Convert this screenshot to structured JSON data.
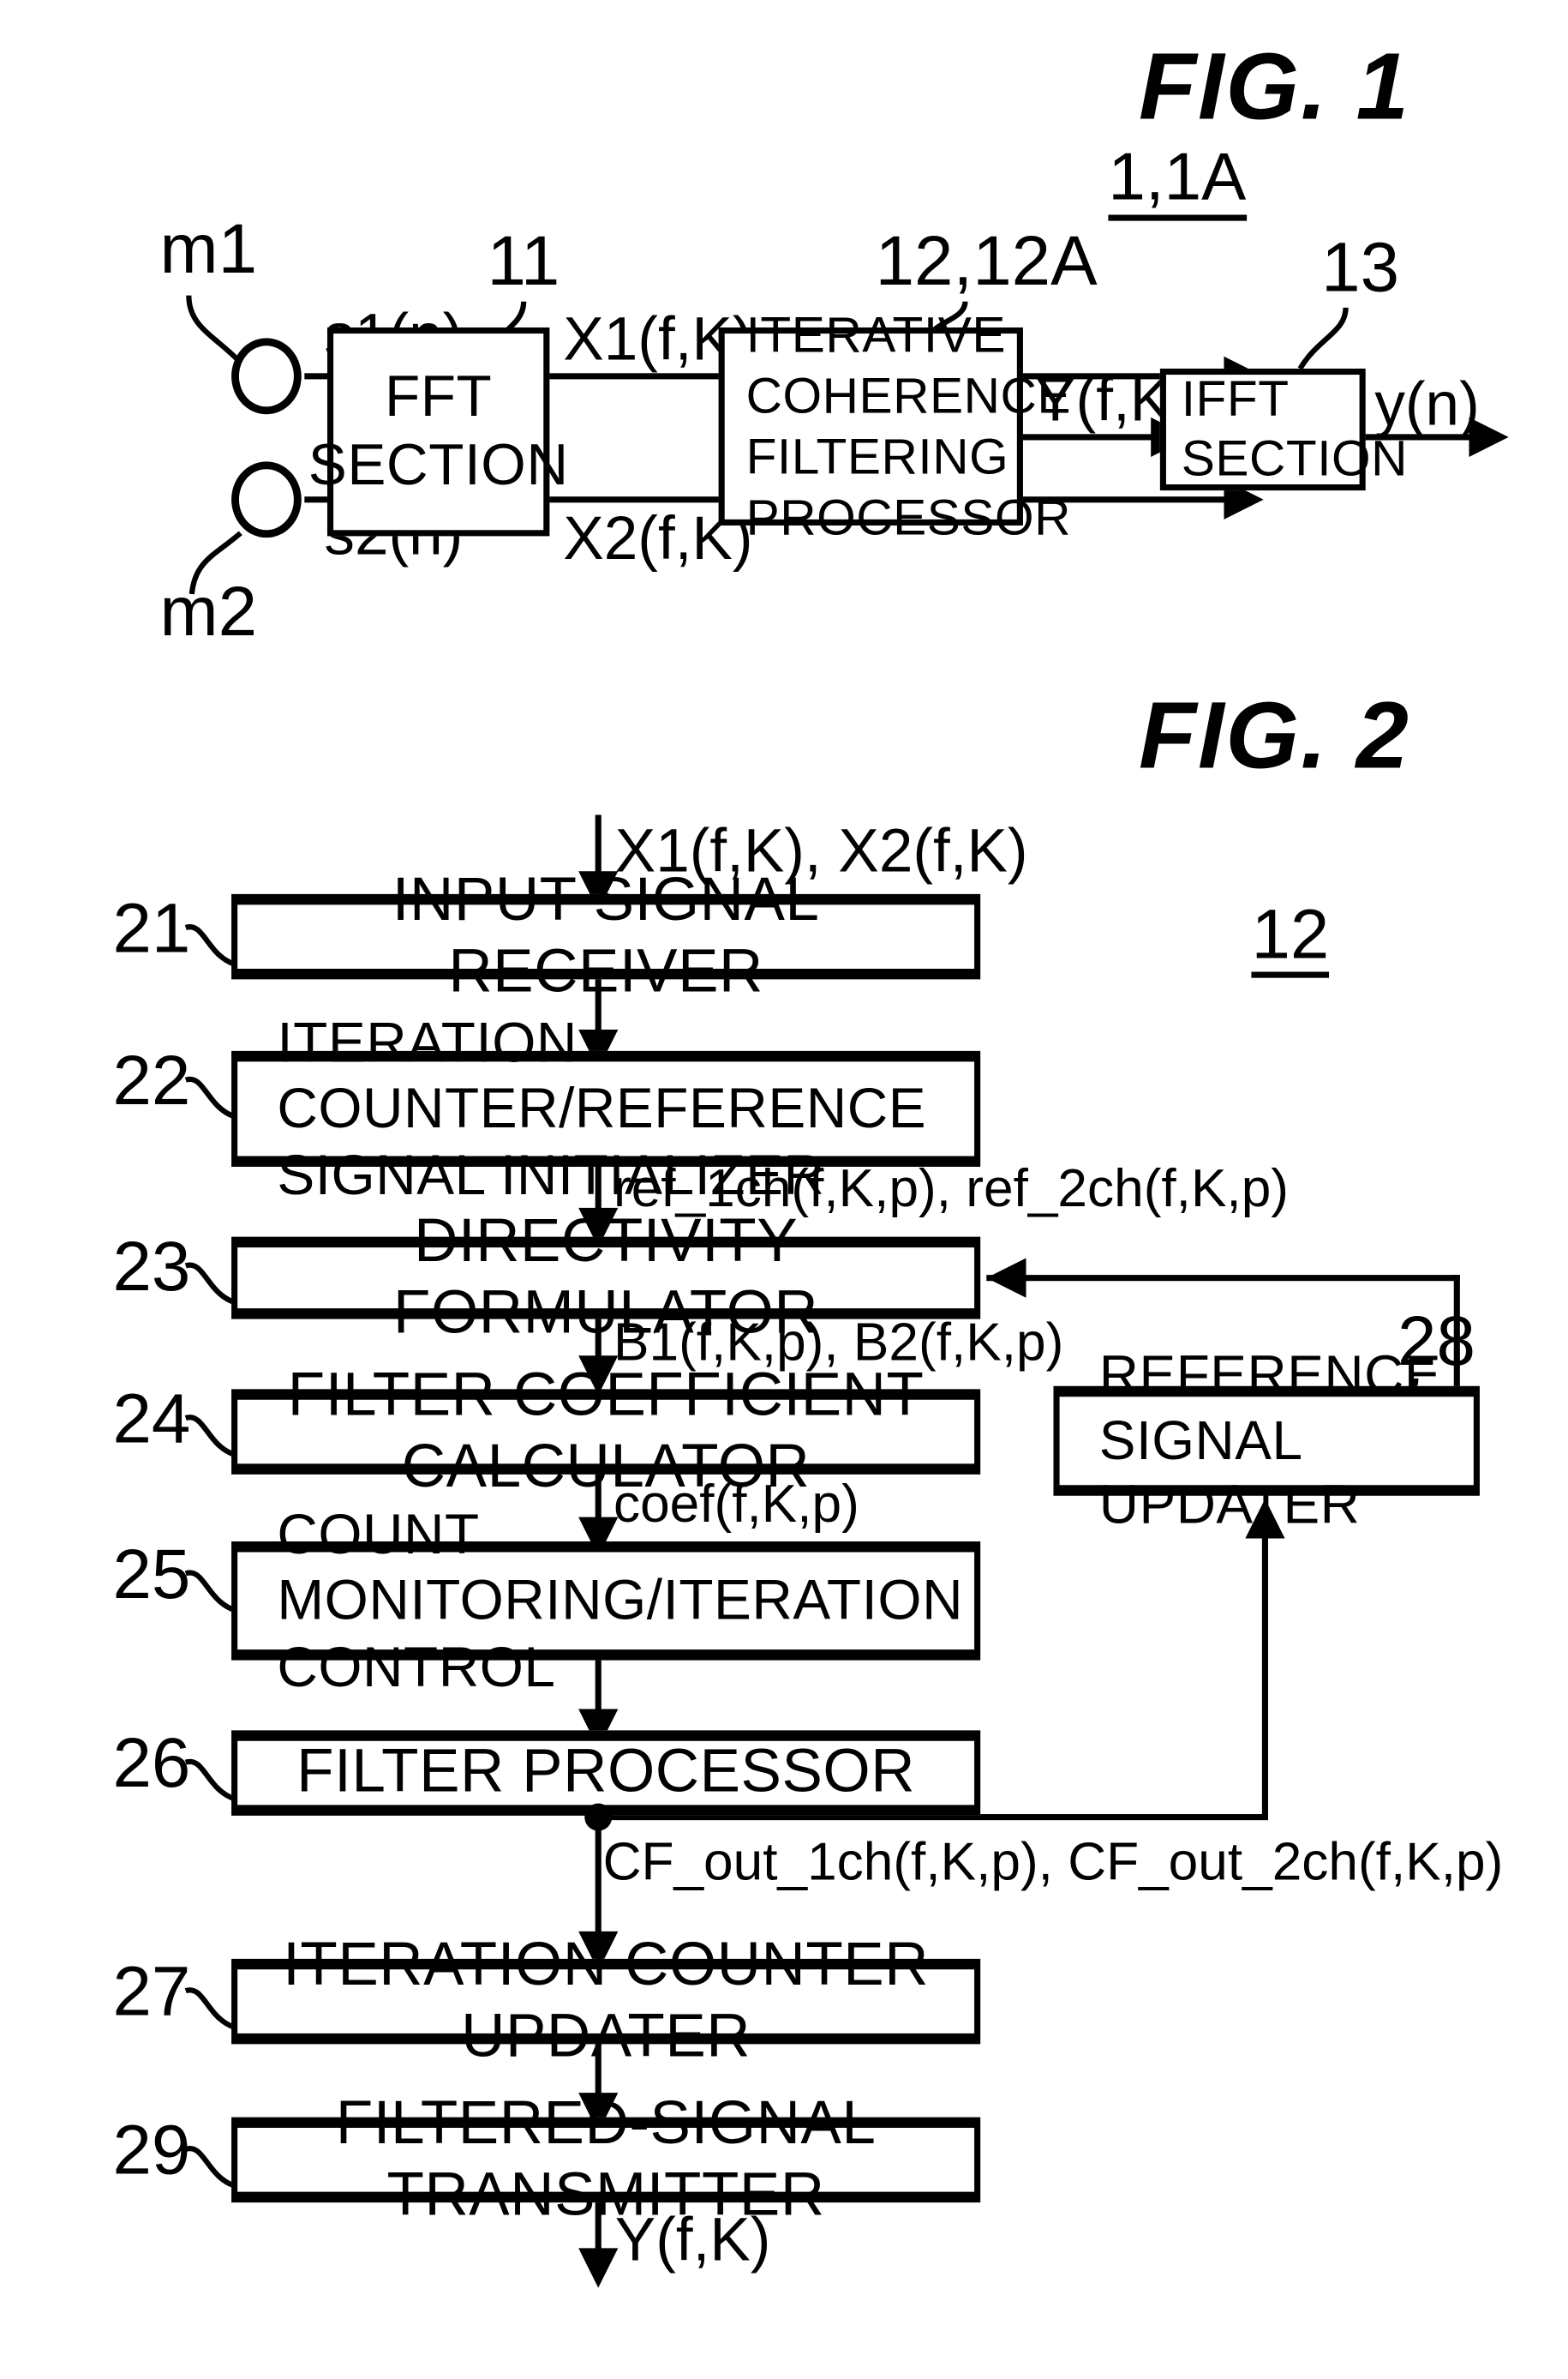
{
  "figures": [
    {
      "title": "FIG. 1",
      "system_ref": "1,1A",
      "mics": [
        {
          "label": "m1",
          "signal": "s1(n)"
        },
        {
          "label": "m2",
          "signal": "s2(n)"
        }
      ],
      "blocks": [
        {
          "ref": "11",
          "line1": "FFT",
          "line2": "SECTION"
        },
        {
          "ref": "12,12A",
          "line1": "ITERATIVE",
          "line2": "COHERENCE",
          "line3": "FILTERING",
          "line4": "PROCESSOR"
        },
        {
          "ref": "13",
          "line1": "IFFT",
          "line2": "SECTION"
        }
      ],
      "signals": {
        "x1": "X1(f,K)",
        "x2": "X2(f,K)",
        "y_freq": "Y(f,K)",
        "y_time": "y(n)"
      }
    },
    {
      "title": "FIG. 2",
      "system_ref": "12",
      "input_signal": "X1(f,K), X2(f,K)",
      "output_signal": "Y(f,K)",
      "blocks": [
        {
          "ref": "21",
          "label": "INPUT SIGNAL RECEIVER",
          "align": "center"
        },
        {
          "ref": "22",
          "label": "ITERATION COUNTER/REFERENCE",
          "label2": "SIGNAL INITIALIZER",
          "align": "left"
        },
        {
          "ref": "23",
          "label": "DIRECTIVITY FORMULATOR",
          "align": "center"
        },
        {
          "ref": "24",
          "label": "FILTER COEFFICIENT CALCULATOR",
          "align": "center"
        },
        {
          "ref": "25",
          "label": "COUNT MONITORING/ITERATION",
          "label2": "CONTROL",
          "align": "left"
        },
        {
          "ref": "26",
          "label": "FILTER PROCESSOR",
          "align": "center"
        },
        {
          "ref": "27",
          "label": "ITERATION COUNTER UPDATER",
          "align": "center"
        },
        {
          "ref": "29",
          "label": "FILTERED-SIGNAL TRANSMITTER",
          "align": "center"
        },
        {
          "ref": "28",
          "label": "REFERENCE SIGNAL",
          "label2": "UPDATER",
          "align": "left"
        }
      ],
      "edge_labels": {
        "ref_signals": "ref_1ch(f,K,p), ref_2ch(f,K,p)",
        "beams": "B1(f,K,p), B2(f,K,p)",
        "coef": "coef(f,K,p)",
        "cf_out": "CF_out_1ch(f,K,p), CF_out_2ch(f,K,p)"
      }
    }
  ],
  "colors": {
    "ink": "#000000",
    "paper": "#ffffff"
  }
}
